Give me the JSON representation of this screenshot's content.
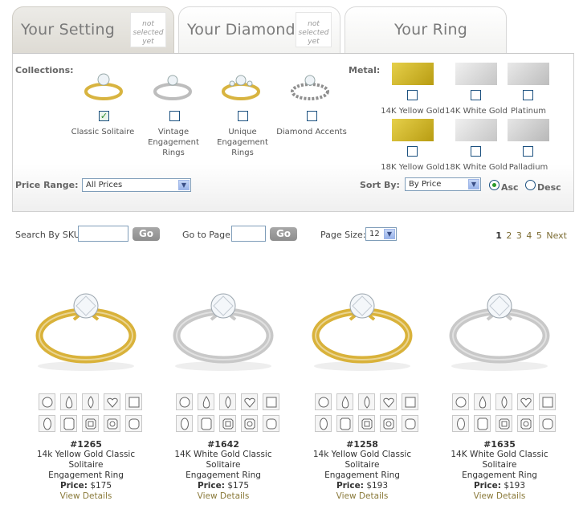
{
  "tabs": [
    {
      "label": "Your Setting",
      "status_line1": "not",
      "status_line2": "selected",
      "status_line3": "yet"
    },
    {
      "label": "Your Diamond",
      "status_line1": "not",
      "status_line2": "selected",
      "status_line3": "yet"
    },
    {
      "label": "Your Ring"
    }
  ],
  "filters": {
    "collections_label": "Collections:",
    "collections": [
      {
        "name_line1": "Classic Solitaire",
        "name_line2": "",
        "name_line3": "",
        "checked": true,
        "metal": "#e2c34a"
      },
      {
        "name_line1": "Vintage",
        "name_line2": "Engagement",
        "name_line3": "Rings",
        "checked": false,
        "metal": "#c9c9c9"
      },
      {
        "name_line1": "Unique",
        "name_line2": "Engagement",
        "name_line3": "Rings",
        "checked": false,
        "metal": "#e2c34a"
      },
      {
        "name_line1": "Diamond Accents",
        "name_line2": "",
        "name_line3": "",
        "checked": false,
        "metal": "#c9c9c9"
      }
    ],
    "metal_label": "Metal:",
    "metals": [
      {
        "name": "14K Yellow Gold",
        "color": "#c9b020"
      },
      {
        "name": "14K White Gold",
        "color": "#d6d6d6"
      },
      {
        "name": "Platinum",
        "color": "#cbcbcb"
      },
      {
        "name": "18K Yellow Gold",
        "color": "#c9b020"
      },
      {
        "name": "18K White Gold",
        "color": "#d6d6d6"
      },
      {
        "name": "Palladium",
        "color": "#c4c4c4"
      }
    ],
    "price_range_label": "Price Range:",
    "price_range_value": "All Prices",
    "sort_by_label": "Sort By:",
    "sort_by_value": "By Price",
    "asc_label": "Asc",
    "desc_label": "Desc"
  },
  "toolbar": {
    "search_sku_label": "Search By SKU:",
    "go_label": "Go",
    "goto_page_label": "Go to Page:",
    "page_size_label": "Page Size:",
    "page_size_value": "12",
    "pages": [
      "1",
      "2",
      "3",
      "4",
      "5"
    ],
    "next_label": "Next"
  },
  "products": [
    {
      "sku": "#1265",
      "name_line1": "14k Yellow Gold Classic Solitaire",
      "name_line2": "Engagement Ring",
      "price_label": "Price:",
      "price": "$175",
      "details": "View Details",
      "metal": "yellow"
    },
    {
      "sku": "#1642",
      "name_line1": "14K White Gold Classic Solitaire",
      "name_line2": "Engagement Ring",
      "price_label": "Price:",
      "price": "$175",
      "details": "View Details",
      "metal": "white"
    },
    {
      "sku": "#1258",
      "name_line1": "14k Yellow Gold Classic Solitaire",
      "name_line2": "Engagement Ring",
      "price_label": "Price:",
      "price": "$193",
      "details": "View Details",
      "metal": "yellow"
    },
    {
      "sku": "#1635",
      "name_line1": "14K White Gold Classic Solitaire",
      "name_line2": "Engagement Ring",
      "price_label": "Price:",
      "price": "$193",
      "details": "View Details",
      "metal": "white"
    }
  ],
  "shape_icons": [
    "round-shape-icon",
    "pear-shape-icon",
    "marquise-shape-icon",
    "heart-shape-icon",
    "princess-shape-icon",
    "oval-shape-icon",
    "emerald-shape-icon",
    "asscher-shape-icon",
    "radiant-shape-icon",
    "cushion-shape-icon"
  ],
  "colors": {
    "yellow_gold": "#d9b23a",
    "white_gold": "#c8c8c8",
    "link": "#8a7a3a",
    "check": "#2a8a2a"
  }
}
